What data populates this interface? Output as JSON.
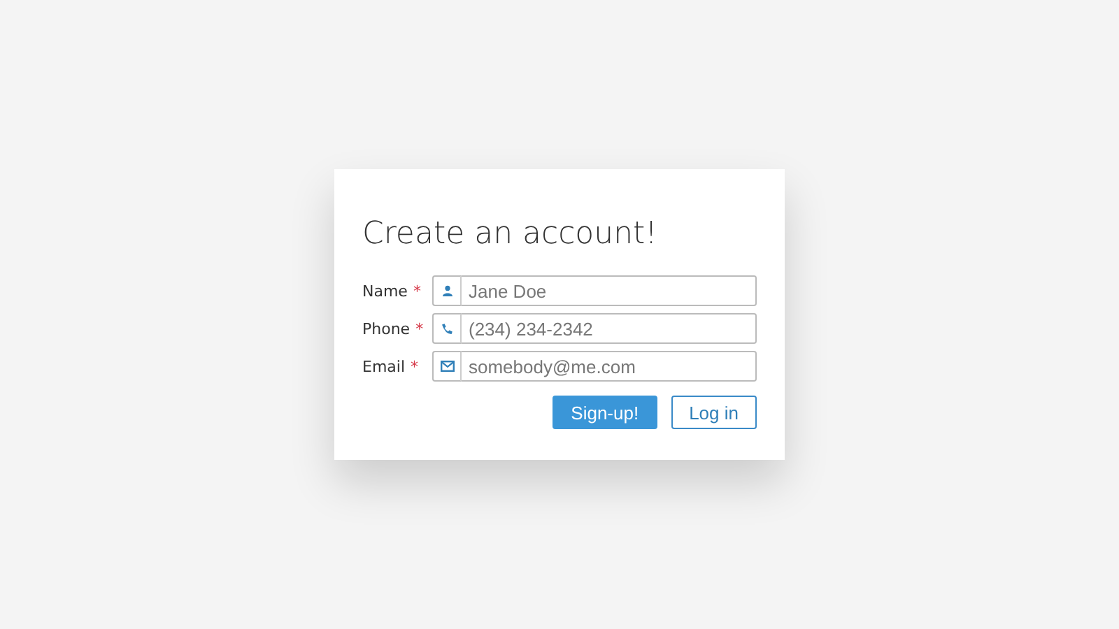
{
  "title": "Create an account!",
  "fields": [
    {
      "label": "Name",
      "required_mark": "*",
      "kind": "person",
      "placeholder": "Jane Doe"
    },
    {
      "label": "Phone",
      "required_mark": "*",
      "kind": "phone",
      "placeholder": "(234) 234-2342"
    },
    {
      "label": "Email",
      "required_mark": "*",
      "kind": "email",
      "placeholder": "somebody@me.com"
    }
  ],
  "buttons": [
    {
      "label": "Sign-up!",
      "kind": "primary"
    },
    {
      "label": "Log in",
      "kind": "secondary"
    }
  ]
}
